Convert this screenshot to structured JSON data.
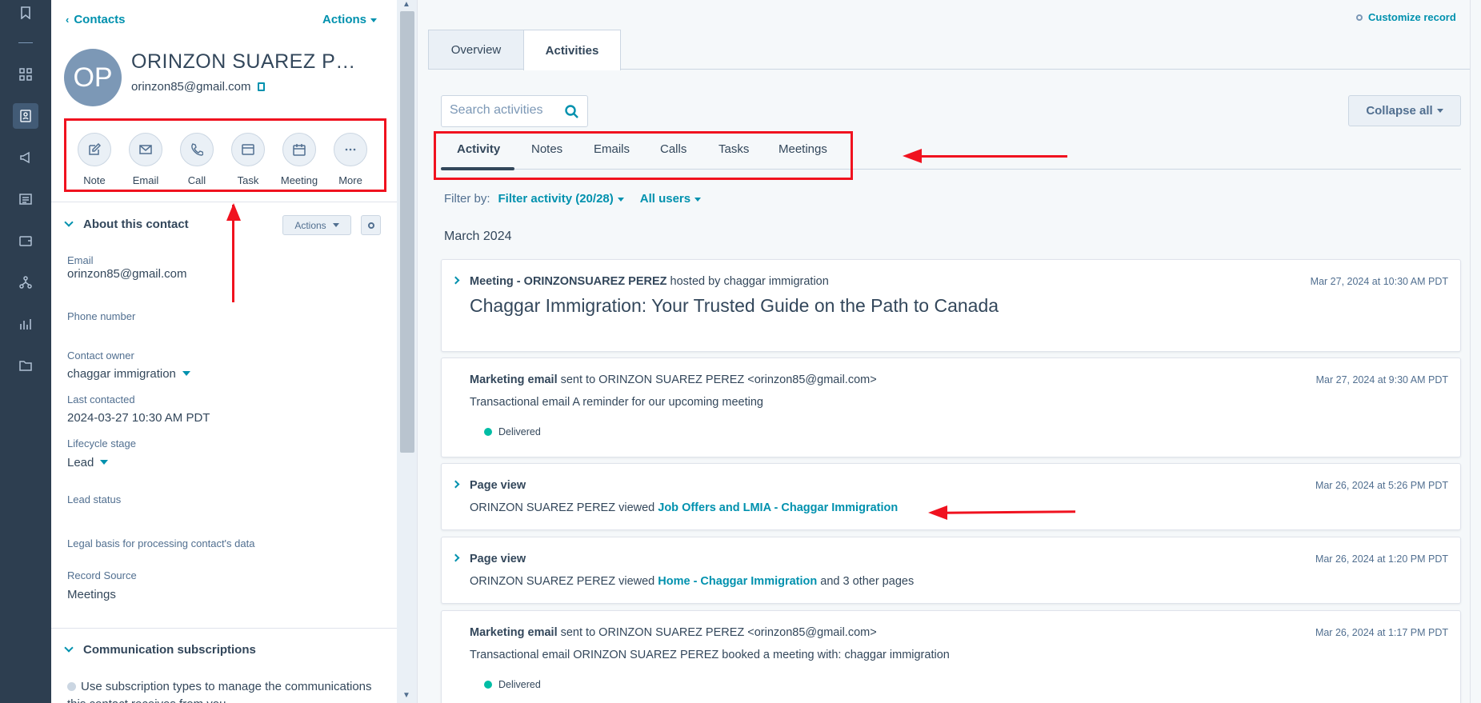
{
  "global_nav": {
    "icons": [
      "bookmark-icon",
      "grid-icon",
      "contacts-icon",
      "megaphone-icon",
      "content-icon",
      "commerce-icon",
      "workflow-icon",
      "reports-icon",
      "folder-icon"
    ]
  },
  "sidebar": {
    "breadcrumb": "Contacts",
    "actions_label": "Actions",
    "avatar_initials": "OP",
    "contact_name": "ORINZON SUAREZ PE...",
    "contact_email": "orinzon85@gmail.com",
    "action_buttons": [
      {
        "label": "Note",
        "icon": "edit-icon"
      },
      {
        "label": "Email",
        "icon": "mail-icon"
      },
      {
        "label": "Call",
        "icon": "phone-icon"
      },
      {
        "label": "Task",
        "icon": "task-icon"
      },
      {
        "label": "Meeting",
        "icon": "calendar-icon"
      },
      {
        "label": "More",
        "icon": "more-icon"
      }
    ],
    "about_section": {
      "title": "About this contact",
      "actions_label": "Actions",
      "properties": [
        {
          "label": "Email",
          "value": "orinzon85@gmail.com"
        },
        {
          "label": "Phone number",
          "value": ""
        },
        {
          "label": "Contact owner",
          "value": "chaggar immigration"
        },
        {
          "label": "Last contacted",
          "value": "2024-03-27 10:30 AM PDT"
        },
        {
          "label": "Lifecycle stage",
          "value": "Lead"
        },
        {
          "label": "Lead status",
          "value": ""
        },
        {
          "label": "Legal basis for processing contact's data",
          "value": ""
        },
        {
          "label": "Record Source",
          "value": "Meetings"
        }
      ]
    },
    "subscriptions_section": {
      "title": "Communication subscriptions",
      "note": "Use subscription types to manage the communications this contact receives from you"
    }
  },
  "main": {
    "customize_label": "Customize record",
    "record_tabs": [
      "Overview",
      "Activities"
    ],
    "search_placeholder": "Search activities",
    "collapse_label": "Collapse all",
    "activity_tabs": [
      "Activity",
      "Notes",
      "Emails",
      "Calls",
      "Tasks",
      "Meetings"
    ],
    "filter": {
      "label": "Filter by:",
      "activity": "Filter activity (20/28)",
      "users": "All users"
    },
    "month": "March 2024",
    "activities": [
      {
        "type": "Meeting - ORINZONSUAREZ PEREZ",
        "rest": " hosted by chaggar immigration",
        "timestamp": "Mar 27, 2024 at 10:30 AM PDT",
        "title": "Chaggar Immigration: Your Trusted Guide on the Path to Canada"
      },
      {
        "type": "Marketing email",
        "rest": " sent to ORINZON SUAREZ PEREZ <orinzon85@gmail.com>",
        "timestamp": "Mar 27, 2024 at 9:30 AM PDT",
        "body": "Transactional email A reminder for our upcoming meeting",
        "status": "Delivered"
      },
      {
        "type": "Page view",
        "timestamp": "Mar 26, 2024 at 5:26 PM PDT",
        "body_prefix": "ORINZON SUAREZ PEREZ viewed ",
        "link": "Job Offers and LMIA - Chaggar Immigration"
      },
      {
        "type": "Page view",
        "timestamp": "Mar 26, 2024 at 1:20 PM PDT",
        "body_prefix": "ORINZON SUAREZ PEREZ viewed ",
        "link": "Home - Chaggar Immigration",
        "body_suffix": " and 3 other pages"
      },
      {
        "type": "Marketing email",
        "rest": " sent to ORINZON SUAREZ PEREZ <orinzon85@gmail.com>",
        "timestamp": "Mar 26, 2024 at 1:17 PM PDT",
        "body": "Transactional email ORINZON SUAREZ PEREZ booked a meeting with: chaggar immigration",
        "status": "Delivered"
      }
    ]
  },
  "colors": {
    "nav_bg": "#2d3e50",
    "accent": "#0091ae",
    "annotation_red": "#f0121f",
    "delivered": "#00bda5"
  }
}
